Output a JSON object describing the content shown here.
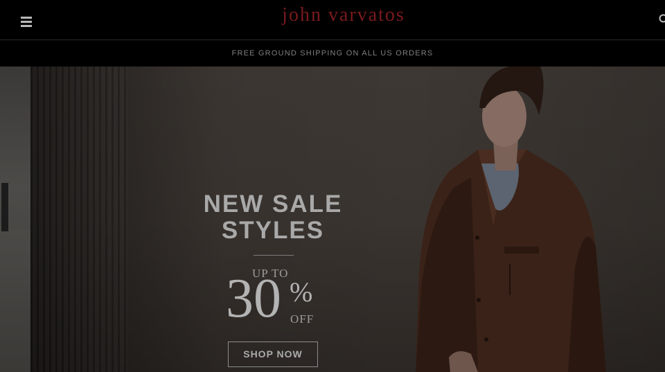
{
  "header": {
    "brand_logo_text": "john varvatos",
    "menu_icon": "hamburger-menu-icon",
    "search_icon": "search-icon"
  },
  "promo_bar": {
    "text": "FREE GROUND SHIPPING ON ALL US ORDERS"
  },
  "hero": {
    "headline": "NEW SALE STYLES",
    "upto": "UP TO",
    "percent_number": "30",
    "percent_sign": "%",
    "off": "OFF",
    "cta_label": "SHOP NOW"
  },
  "colors": {
    "logo": "#7a1a1e",
    "promo_text": "#7f7f7f",
    "header_bg": "#000000",
    "hero_text": "#a9a9a9"
  }
}
